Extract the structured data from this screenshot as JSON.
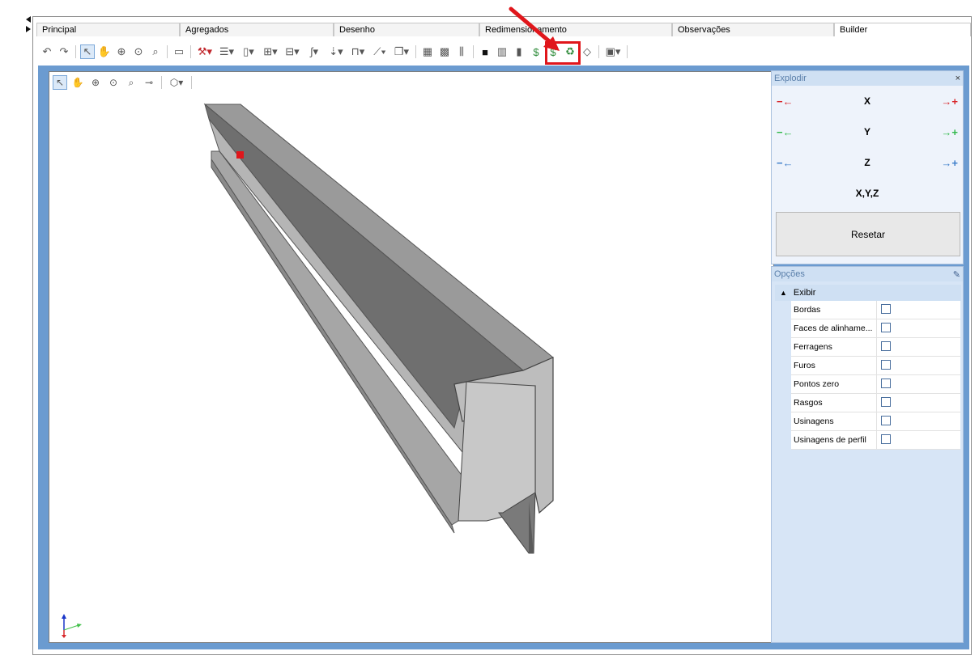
{
  "tabs": [
    {
      "label": "Principal"
    },
    {
      "label": "Agregados"
    },
    {
      "label": "Desenho"
    },
    {
      "label": "Redimensionamento"
    },
    {
      "label": "Observações"
    },
    {
      "label": "Builder"
    }
  ],
  "explodir": {
    "title": "Explodir",
    "close": "×",
    "axes": [
      {
        "label": "X",
        "color": "#d8282c"
      },
      {
        "label": "Y",
        "color": "#30b84a"
      },
      {
        "label": "Z",
        "color": "#3b7cc9"
      }
    ],
    "xyz_label": "X,Y,Z",
    "reset_label": "Resetar"
  },
  "opcoes": {
    "title": "Opções",
    "group": "Exibir",
    "options": [
      {
        "label": "Bordas",
        "checked": false
      },
      {
        "label": "Faces de alinhame...",
        "checked": false
      },
      {
        "label": "Ferragens",
        "checked": false
      },
      {
        "label": "Furos",
        "checked": false
      },
      {
        "label": "Pontos zero",
        "checked": false
      },
      {
        "label": "Rasgos",
        "checked": false
      },
      {
        "label": "Usinagens",
        "checked": false
      },
      {
        "label": "Usinagens de perfil",
        "checked": false
      }
    ]
  },
  "colors": {
    "accent": "#6b9bd0",
    "highlight": "#e0161b"
  }
}
